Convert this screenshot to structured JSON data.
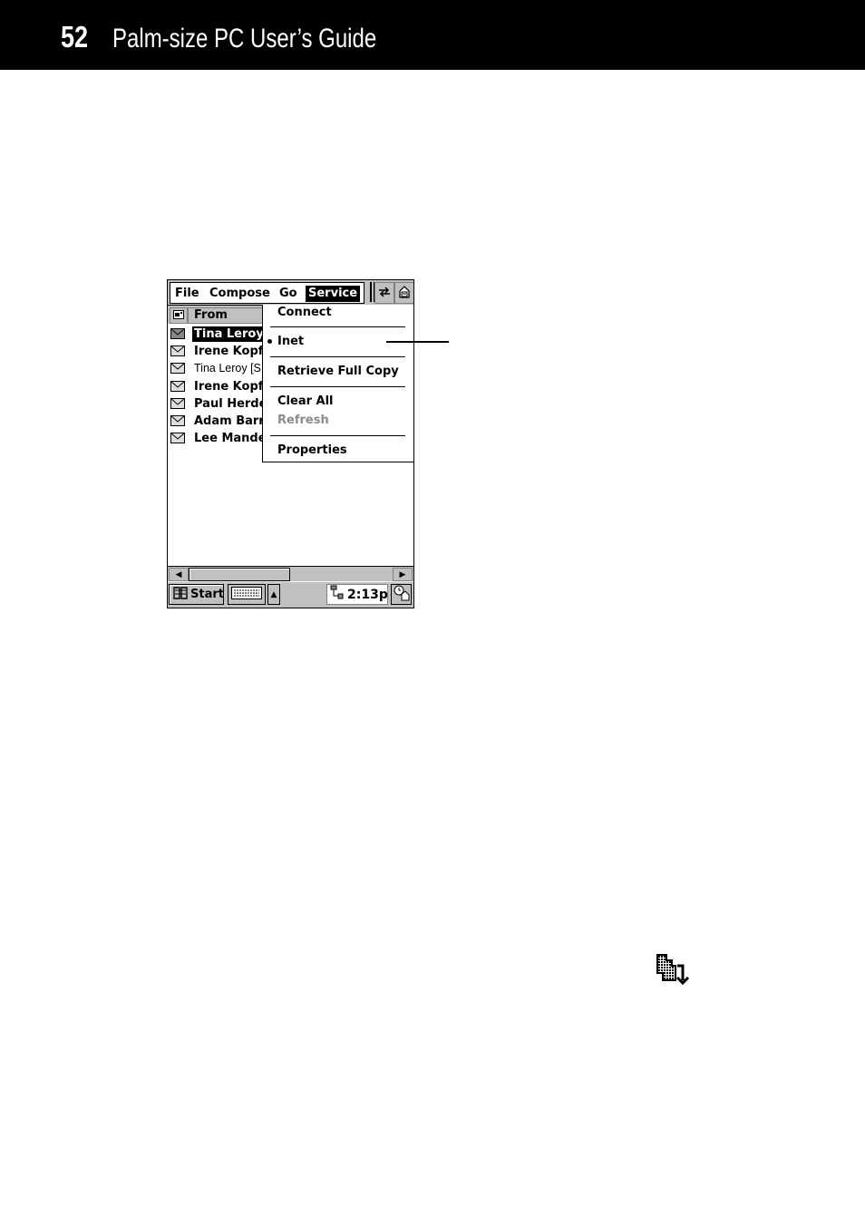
{
  "page": {
    "number": "52",
    "title": "Palm-size PC User’s Guide"
  },
  "screen": {
    "menubar": {
      "items": [
        {
          "label": "File",
          "active": false
        },
        {
          "label": "Compose",
          "active": false
        },
        {
          "label": "Go",
          "active": false
        },
        {
          "label": "Service",
          "active": true
        }
      ],
      "toolbar_icons": [
        "sync-arrows-icon",
        "inbox-folder-icon"
      ]
    },
    "list": {
      "column_header": "From",
      "column_icon": "envelope-sort-icon",
      "rows": [
        {
          "from": "Tina Leroy",
          "state": "selected"
        },
        {
          "from": "Irene Kopf",
          "state": "unread"
        },
        {
          "from": "Tina Leroy [S",
          "state": "read"
        },
        {
          "from": "Irene Kopf",
          "state": "unread"
        },
        {
          "from": "Paul Herde",
          "state": "unread"
        },
        {
          "from": "Adam Barr",
          "state": "unread"
        },
        {
          "from": "Lee Mandel",
          "state": "unread"
        }
      ]
    },
    "service_menu": {
      "items": [
        {
          "label": "Connect",
          "enabled": true,
          "checked": false
        },
        {
          "label": "Inet",
          "enabled": true,
          "checked": true
        },
        {
          "label": "Retrieve Full Copy",
          "enabled": true,
          "checked": false
        },
        {
          "label": "Clear All",
          "enabled": true,
          "checked": false
        },
        {
          "label": "Refresh",
          "enabled": false,
          "checked": false
        },
        {
          "label": "Properties",
          "enabled": true,
          "checked": false
        }
      ]
    },
    "taskbar": {
      "start_label": "Start",
      "clock": "2:13p"
    }
  }
}
